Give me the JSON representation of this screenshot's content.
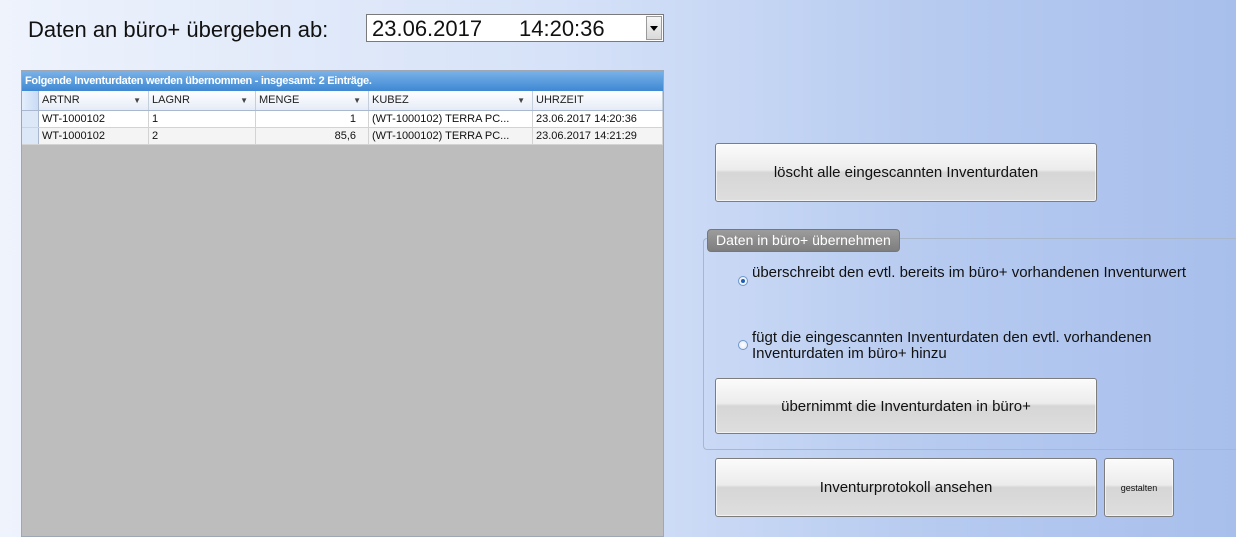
{
  "header": {
    "label": "Daten an büro+ übergeben ab:",
    "date_value": "23.06.2017",
    "time_value": "14:20:36"
  },
  "grid": {
    "title": "Folgende Inventurdaten werden übernommen - insgesamt: 2 Einträge.",
    "columns": [
      "ARTNR",
      "LAGNR",
      "MENGE",
      "KUBEZ",
      "UHRZEIT"
    ],
    "rows": [
      [
        "WT-1000102",
        "1",
        "1",
        "(WT-1000102) TERRA PC...",
        "23.06.2017 14:20:36"
      ],
      [
        "WT-1000102",
        "2",
        "85,6",
        "(WT-1000102) TERRA PC...",
        "23.06.2017 14:21:29"
      ]
    ]
  },
  "buttons": {
    "clear": "löscht alle eingescannten Inventurdaten",
    "take_over": "übernimmt die Inventurdaten in büro+",
    "protocol": "Inventurprotokoll ansehen",
    "design": "gestalten"
  },
  "group": {
    "title": "Daten in büro+ übernehmen",
    "option_overwrite": "überschreibt den evtl. bereits im büro+ vorhandenen Inventurwert",
    "option_add": "fügt die eingescannten Inventurdaten den evtl. vorhandenen Inventurdaten im büro+ hinzu",
    "selected": "overwrite"
  },
  "colors": {
    "grid_title_bar": "#3f88d3",
    "grid_background": "#bdbdbd",
    "group_title": "#8a8a8a"
  }
}
